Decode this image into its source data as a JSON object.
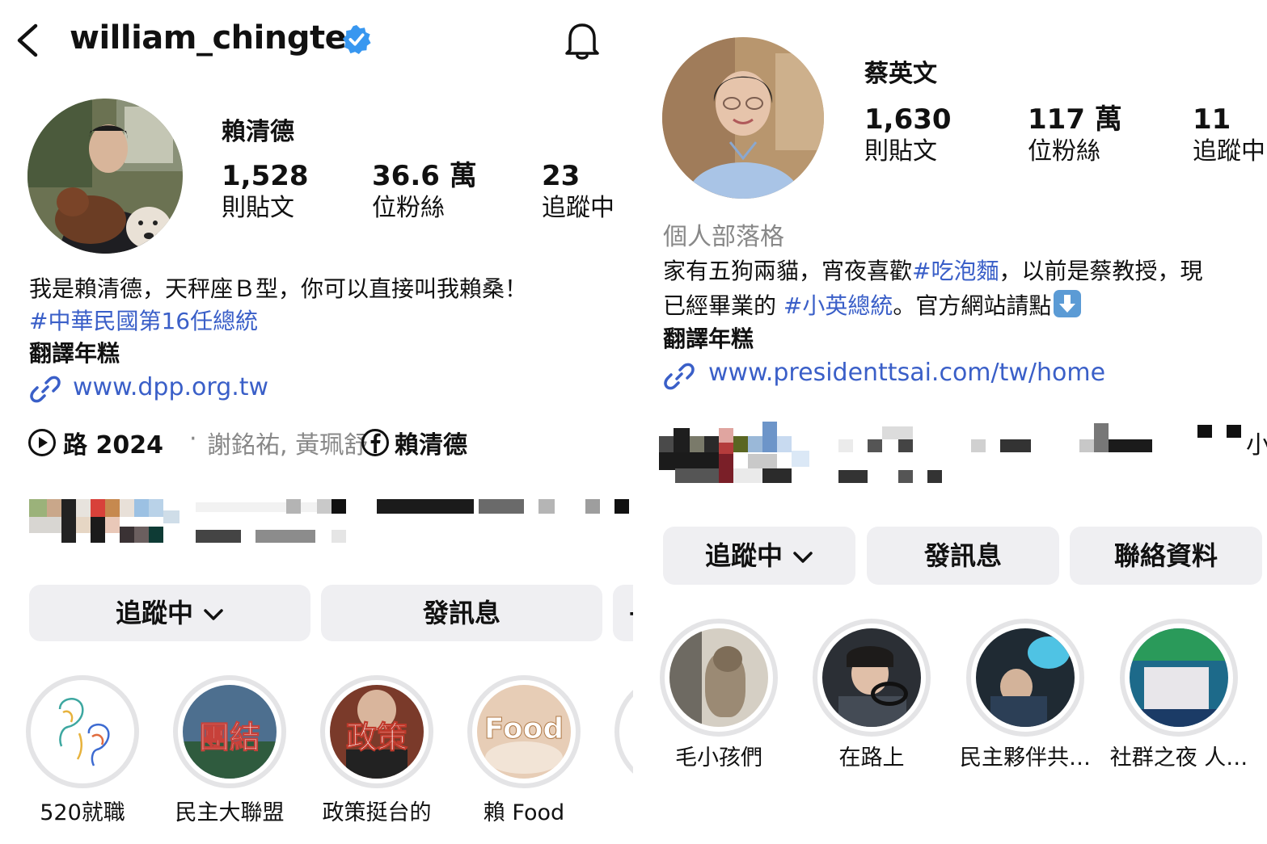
{
  "left": {
    "username": "william_chingte",
    "display_name": "賴清德",
    "stats": [
      {
        "number": "1,528",
        "label": "則貼文"
      },
      {
        "number": "36.6 萬",
        "label": "位粉絲"
      },
      {
        "number": "23",
        "label": "追蹤中"
      }
    ],
    "bio": {
      "line1": "我是賴清德，天秤座Ｂ型，你可以直接叫我賴桑！",
      "hashtag": "#中華民國第16任總統",
      "translate": "翻譯年糕"
    },
    "link": "www.dpp.org.tw",
    "meta": {
      "music": "路 2024",
      "separator": "·",
      "artists": "謝銘祐, 黃珮舒",
      "facebook": "賴清德"
    },
    "buttons": {
      "follow": "追蹤中",
      "message": "發訊息",
      "partial": "+"
    },
    "highlights": [
      {
        "label": "520就職",
        "badge": ""
      },
      {
        "label": "民主大聯盟",
        "badge": "團結"
      },
      {
        "label": "政策挺台的",
        "badge": "政策"
      },
      {
        "label": "賴 Food",
        "badge": "Food"
      }
    ]
  },
  "right": {
    "display_name": "蔡英文",
    "stats": [
      {
        "number": "1,630",
        "label": "則貼文"
      },
      {
        "number": "117 萬",
        "label": "位粉絲"
      },
      {
        "number": "11",
        "label": "追蹤中"
      }
    ],
    "category": "個人部落格",
    "bio": {
      "l1_pre": "家有五狗兩貓，宵夜喜歡",
      "l1_tag": "#吃泡麵",
      "l1_post": "，以前是蔡教授，現",
      "l2_pre": "已經畢業的 ",
      "l2_tag": "#小英總統",
      "l2_post": "。官方網站請點",
      "translate": "翻譯年糕"
    },
    "link": "www.presidenttsai.com/tw/home",
    "buttons": {
      "follow": "追蹤中",
      "message": "發訊息",
      "contact": "聯絡資料"
    },
    "highlights": [
      {
        "label": "毛小孩們"
      },
      {
        "label": "在路上"
      },
      {
        "label": "民主夥伴共…"
      },
      {
        "label": "社群之夜 人…"
      }
    ],
    "partial_glyph": "小"
  },
  "colors": {
    "link": "#3a5fc8",
    "verified": "#3897f0",
    "button_bg": "#efeff2",
    "ring": "#e4e4e6"
  }
}
